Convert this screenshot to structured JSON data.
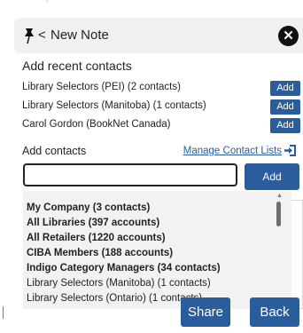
{
  "header": {
    "back_glyph": "<",
    "title": "New Note",
    "close_glyph": "✕"
  },
  "recent": {
    "title": "Add recent contacts",
    "items": [
      {
        "label": "Library Selectors (PEI) (2 contacts)",
        "button": "Add"
      },
      {
        "label": "Library Selectors (Manitoba) (1 contacts)",
        "button": "Add"
      },
      {
        "label": "Carol Gordon (BookNet Canada)",
        "button": "Add"
      }
    ]
  },
  "contacts": {
    "title": "Add contacts",
    "manage_link": "Manage Contact Lists",
    "input_value": "",
    "add_button": "Add"
  },
  "dropdown": {
    "items": [
      {
        "label": "My Company (3 contacts)",
        "bold": true
      },
      {
        "label": "All Libraries (397 accounts)",
        "bold": true
      },
      {
        "label": "All Retailers (1220 accounts)",
        "bold": true
      },
      {
        "label": "CIBA Members (188 accounts)",
        "bold": true
      },
      {
        "label": "Indigo Category Managers (34 contacts)",
        "bold": true
      },
      {
        "label": "Library Selectors (Manitoba) (1 contacts)",
        "bold": false
      },
      {
        "label": "Library Selectors (Ontario) (1 contacts)",
        "bold": false
      }
    ]
  },
  "footer": {
    "share": "Share",
    "back": "Back"
  },
  "colors": {
    "accent": "#2a5d9c",
    "header_bg": "#f0f0f0",
    "dropdown_bg": "#f2f2f2"
  },
  "icons": {
    "pin": "pushpin-icon",
    "close": "close-icon",
    "manage": "contact-list-icon"
  }
}
